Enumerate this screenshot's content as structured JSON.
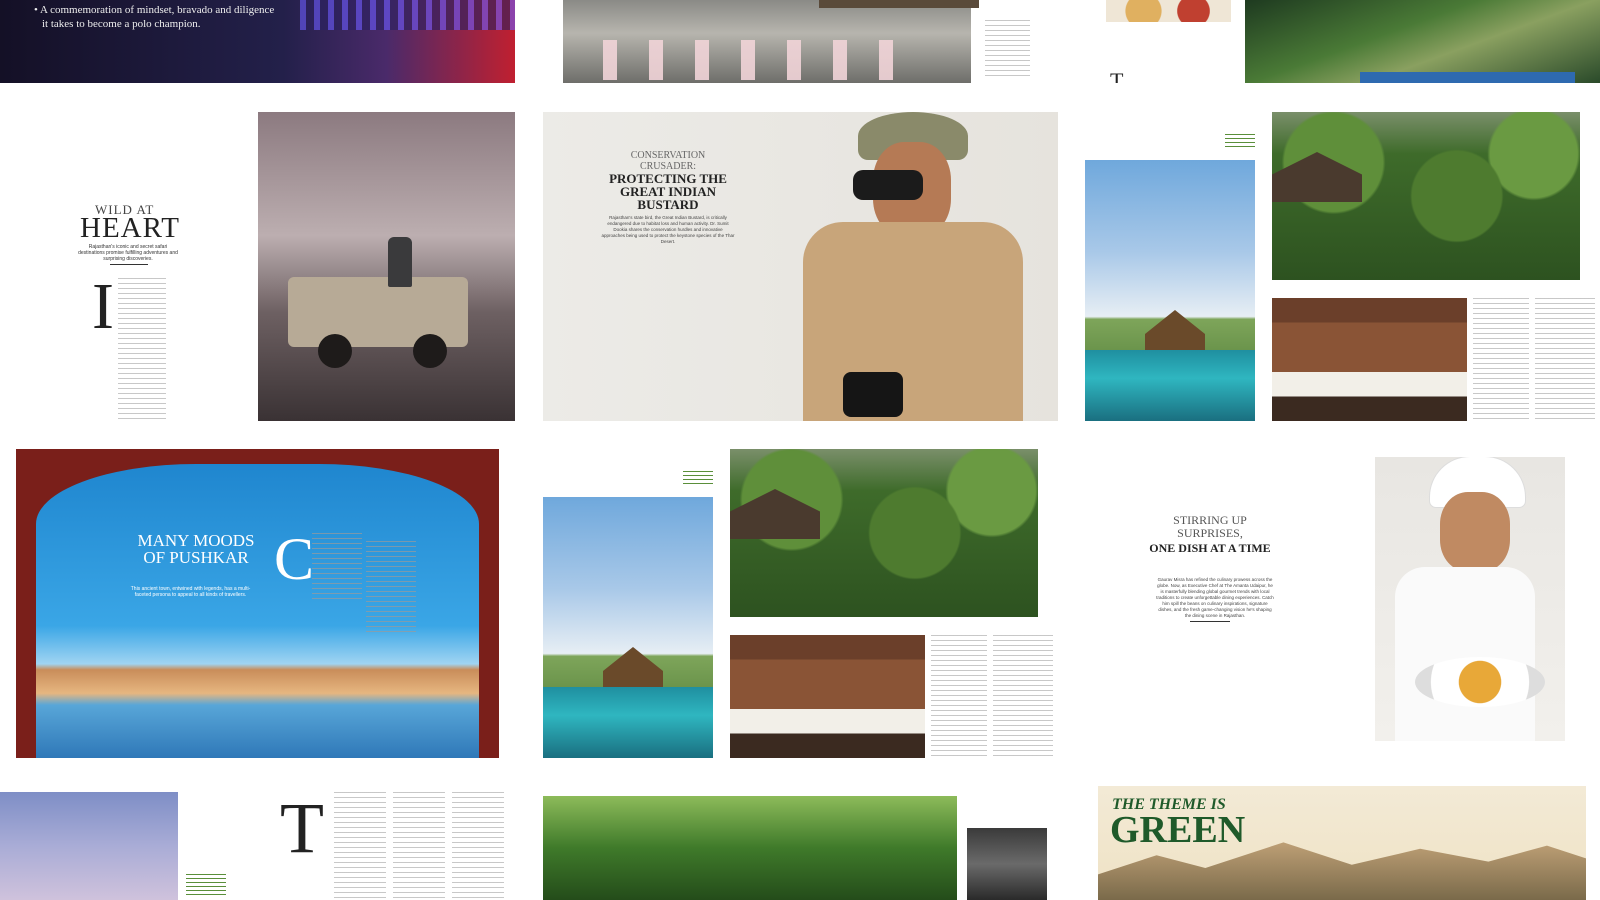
{
  "polo": {
    "bullets": [
      "•  A commemoration of mindset, bravado and diligence",
      "it takes to become a polo champion."
    ]
  },
  "wild": {
    "kicker": "WILD AT",
    "title": "HEART",
    "subtitle": "Rajasthan's iconic and secret safari destinations promise fulfilling adventures and surprising discoveries.",
    "dropcap": "I"
  },
  "bustard": {
    "kicker": "CONSERVATION CRUSADER:",
    "title": "PROTECTING THE GREAT INDIAN BUSTARD",
    "subtitle": "Rajasthan's state bird, the Great Indian Bustard, is critically endangered due to habitat loss and human activity. Dr. Sumit Dookia shares the conservation hurdles and innovative approaches being used to protect the keystone species of the Thar Desert."
  },
  "pushkar": {
    "title": "MANY MOODS OF PUSHKAR",
    "subtitle": "This ancient town, entwined with legends, has a multi-faceted persona to appeal to all kinds of travellers.",
    "dropcap": "C"
  },
  "food": {
    "title_top": "STIRRING UP SURPRISES,",
    "title_bottom": "ONE DISH AT A TIME",
    "subtitle": "Gaurav Misra has refined the culinary prowess across the globe. Now, as Executive Chef at The Amanta Udaipur, he is masterfully blending global gourmet trends with local traditions to create unforgettable dining experiences. Catch him spill the beans on culinary inspirations, signature dishes, and the fresh game-changing vision he's shaping the dining scene in Rajasthan."
  },
  "theme": {
    "title_top": "THE THEME IS",
    "title_bottom": "GREEN"
  },
  "dropcap_t": "T",
  "colors": {
    "accent_green": "#1f5a2a",
    "text_dark": "#222222"
  }
}
